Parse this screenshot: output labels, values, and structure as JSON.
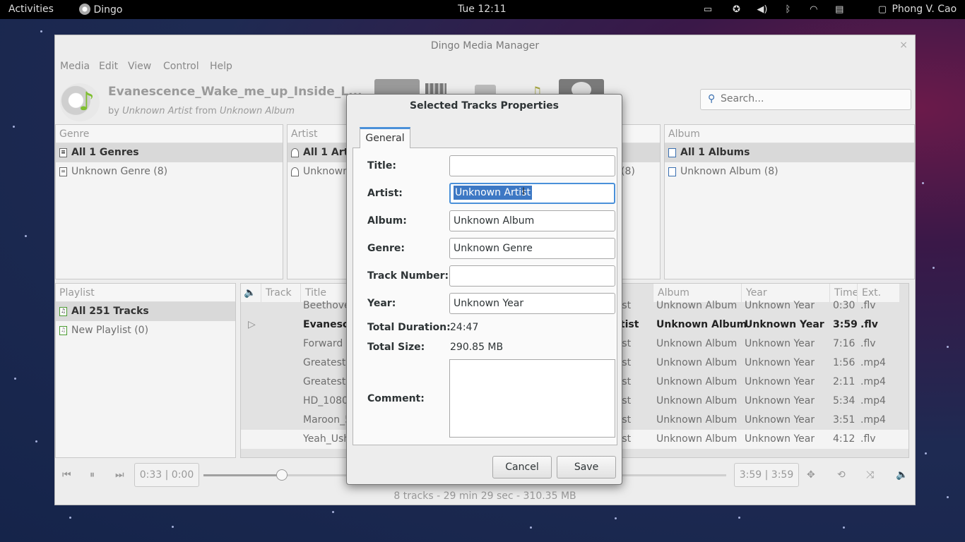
{
  "topbar": {
    "activities": "Activities",
    "app_name": "Dingo",
    "clock": "Tue 12:11",
    "user": "Phong V. Cao"
  },
  "window": {
    "title": "Dingo Media Manager",
    "close": "×",
    "menu": [
      "Media",
      "Edit",
      "View",
      "Control",
      "Help"
    ],
    "now_playing": {
      "title": "Evanescence_Wake_me_up_Inside_L...",
      "by": "by",
      "artist": "Unknown Artist",
      "from": "from",
      "album": "Unknown Album"
    },
    "search_placeholder": "Search..."
  },
  "panes": {
    "genre": {
      "header": "Genre",
      "rows": [
        "All 1 Genres",
        "Unknown Genre (8)"
      ]
    },
    "artist": {
      "header": "Artist",
      "rows": [
        "All 1 Arti",
        "Unknown"
      ],
      "count": "(8)"
    },
    "album": {
      "header": "Album",
      "rows": [
        "All 1 Albums",
        "Unknown Album (8)"
      ]
    },
    "playlist": {
      "header": "Playlist",
      "rows": [
        "All 251 Tracks",
        "New Playlist (0)"
      ]
    }
  },
  "tracks": {
    "headers": [
      "Track",
      "Title",
      "Album",
      "Year",
      "Time",
      "Ext."
    ],
    "rows": [
      {
        "title": "Beethove",
        "artist": "tist",
        "album": "Unknown Album",
        "year": "Unknown Year",
        "time": "0:30",
        "ext": ".flv"
      },
      {
        "title": "Evanesce",
        "artist": "rtist",
        "album": "Unknown Album",
        "year": "Unknown Year",
        "time": "3:59",
        "ext": ".flv"
      },
      {
        "title": "Forward",
        "artist": "tist",
        "album": "Unknown Album",
        "year": "Unknown Year",
        "time": "7:16",
        "ext": ".flv"
      },
      {
        "title": "Greatest.",
        "artist": "tist",
        "album": "Unknown Album",
        "year": "Unknown Year",
        "time": "1:56",
        "ext": ".mp4"
      },
      {
        "title": "Greatest.",
        "artist": "tist",
        "album": "Unknown Album",
        "year": "Unknown Year",
        "time": "2:11",
        "ext": ".mp4"
      },
      {
        "title": "HD_1080",
        "artist": "tist",
        "album": "Unknown Album",
        "year": "Unknown Year",
        "time": "5:34",
        "ext": ".mp4"
      },
      {
        "title": "Maroon_5",
        "artist": "tist",
        "album": "Unknown Album",
        "year": "Unknown Year",
        "time": "3:51",
        "ext": ".mp4"
      },
      {
        "title": "Yeah_Ush",
        "artist": "tist",
        "album": "Unknown Album",
        "year": "Unknown Year",
        "time": "4:12",
        "ext": ".flv"
      }
    ]
  },
  "controls": {
    "elapsed": "0:33 | 0:00",
    "total": "3:59 | 3:59",
    "progress_fraction": 0.15
  },
  "status": "8 tracks - 29 min 29 sec - 310.35 MB",
  "dialog": {
    "title": "Selected Tracks Properties",
    "tab": "General",
    "fields": {
      "title_label": "Title:",
      "title_value": "",
      "artist_label": "Artist:",
      "artist_value": "Unknown Artist",
      "album_label": "Album:",
      "album_value": "Unknown Album",
      "genre_label": "Genre:",
      "genre_value": "Unknown Genre",
      "track_label": "Track Number:",
      "track_value": "",
      "year_label": "Year:",
      "year_value": "Unknown Year",
      "duration_label": "Total Duration:",
      "duration_value": "24:47",
      "size_label": "Total Size:",
      "size_value": "290.85 MB",
      "comment_label": "Comment:"
    },
    "cancel": "Cancel",
    "save": "Save"
  },
  "colors": {
    "accent": "#4a90d9",
    "selection": "#3d78c4"
  }
}
